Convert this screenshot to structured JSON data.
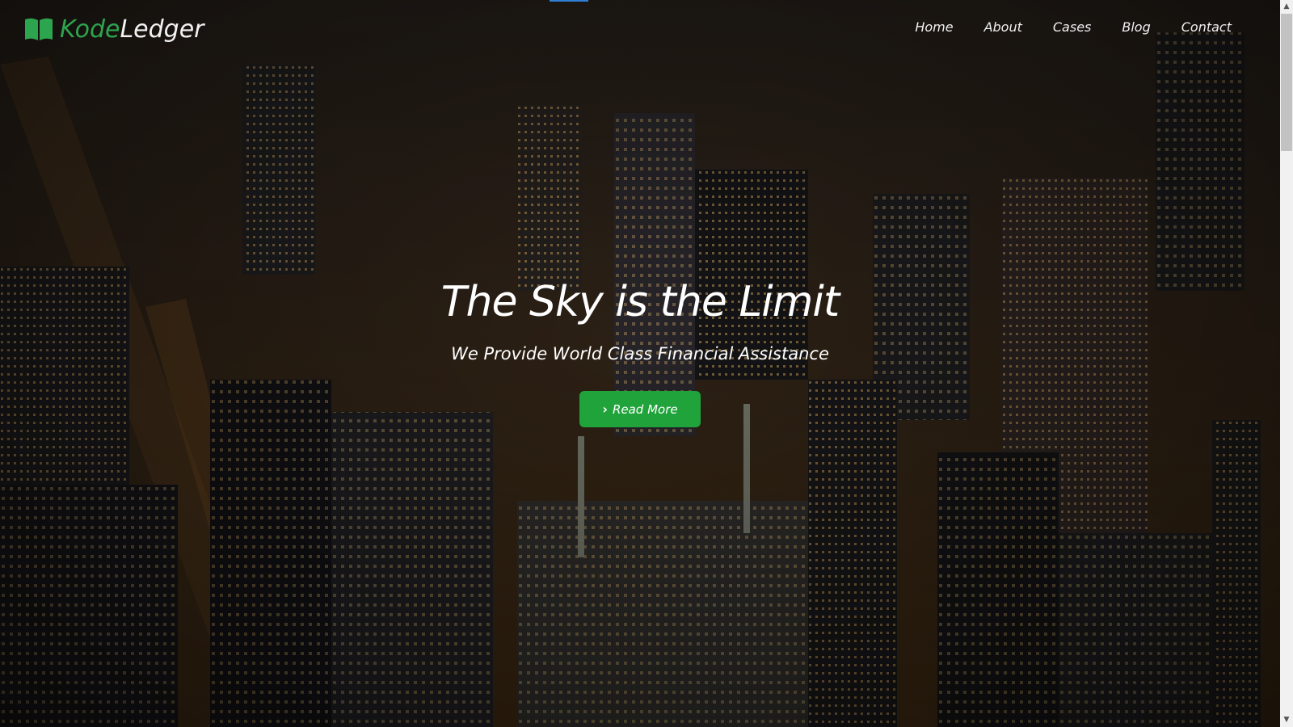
{
  "brand": {
    "part1": "Kode",
    "part2": "Ledger",
    "icon": "book-icon"
  },
  "nav": {
    "items": [
      "Home",
      "About",
      "Cases",
      "Blog",
      "Contact"
    ]
  },
  "hero": {
    "title": "The Sky is the Limit",
    "subtitle": "We Provide World Class Financial Assistance",
    "cta_label": "Read More",
    "cta_icon": "chevron-right-icon",
    "background": "city-night-aerial"
  },
  "colors": {
    "accent": "#1fa33a",
    "brand_green": "#2da44e",
    "text": "#ffffff"
  }
}
